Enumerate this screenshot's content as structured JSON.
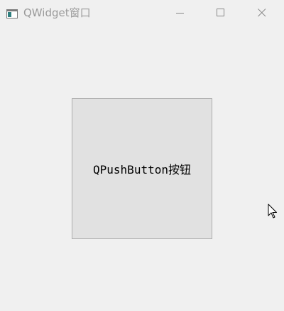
{
  "window": {
    "title": "QWidget窗口",
    "icons": {
      "app": "app-window-icon",
      "minimize": "minimize-icon",
      "maximize": "maximize-icon",
      "close": "close-icon"
    }
  },
  "content": {
    "button_label": "QPushButton按钮"
  },
  "pointer": {
    "icon": "mouse-pointer-icon"
  },
  "colors": {
    "window_bg": "#f0f0f0",
    "title_text": "#9a9a9a",
    "button_bg": "#e1e1e1",
    "button_border": "#adadad",
    "button_text": "#000000"
  }
}
